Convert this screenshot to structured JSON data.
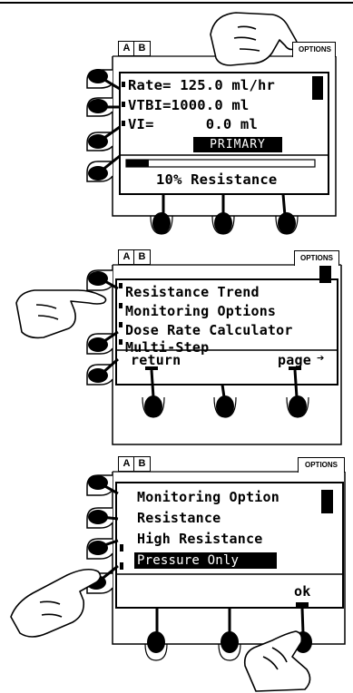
{
  "panel1": {
    "tab_a": "A",
    "tab_b": "B",
    "options": "OPTIONS",
    "rate": "Rate= 125.0 ml/hr",
    "vtbi": "VTBI=1000.0 ml",
    "vi": "VI=      0.0 ml",
    "mode": "PRIMARY",
    "status": "10% Resistance",
    "resistance_level_fraction": 0.12
  },
  "panel2": {
    "tab_a": "A",
    "tab_b": "B",
    "options": "OPTIONS",
    "items": [
      "Resistance Trend",
      "Monitoring Options",
      "Dose Rate Calculator",
      "Multi-Step"
    ],
    "return_label": "return",
    "page_label": "page",
    "page_arrow": "➔"
  },
  "panel3": {
    "tab_a": "A",
    "tab_b": "B",
    "options": "OPTIONS",
    "title": "Monitoring Option",
    "items": [
      "Resistance",
      "High Resistance",
      "Pressure Only"
    ],
    "selected_index": 2,
    "ok_label": "ok"
  },
  "icons": [
    "pointing-hand-icon",
    "side-key-icon",
    "bottom-key-icon",
    "scrollbar-thumb-icon"
  ],
  "colors": {
    "ink": "#000000",
    "paper": "#ffffff"
  }
}
